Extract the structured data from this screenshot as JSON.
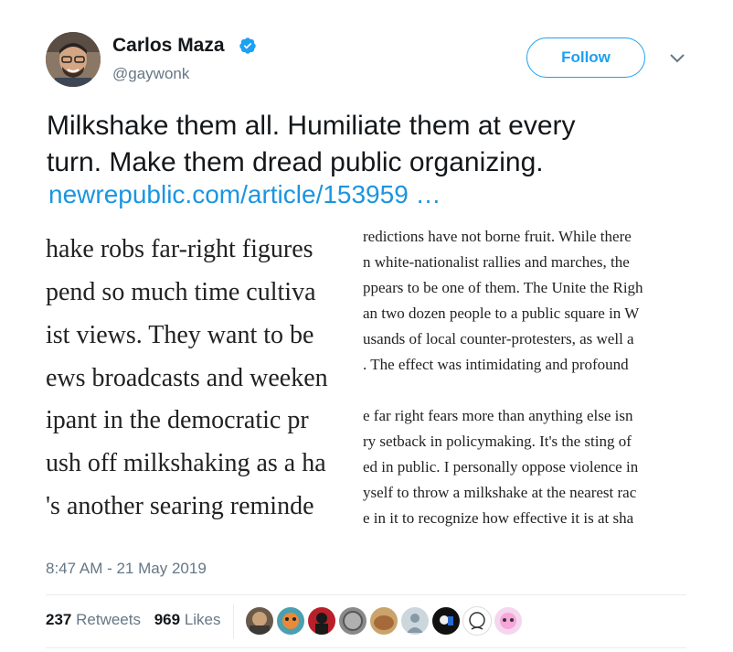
{
  "author": {
    "name": "Carlos Maza",
    "handle": "@gaywonk",
    "verified": true
  },
  "follow_label": "Follow",
  "tweet": {
    "text_line1": "Milkshake them all. Humiliate them at every",
    "text_line2": "turn. Make them dread public organizing.",
    "link": "newrepublic.com/article/153959 …"
  },
  "media": {
    "left_lines": [
      "hake robs far-right figures",
      "pend so much time cultiva",
      "ist views. They want to be",
      "ews broadcasts and weeken",
      "ipant in the democratic pr",
      "ush off milkshaking as a ha",
      "'s another searing reminde"
    ],
    "right_lines": [
      "redictions have not borne fruit. While there",
      "n white-nationalist rallies and marches, the",
      "ppears to be one of them. The Unite the Righ",
      "an two dozen people to a public square in W",
      "usands of local counter-protesters, as well a",
      ". The effect was intimidating and profound",
      "e far right fears more than anything else isn",
      "ry setback in policymaking. It's the sting of",
      "ed in public. I personally oppose violence in",
      "yself to throw a milkshake at the nearest rac",
      "e in it to recognize how effective it is at sha"
    ]
  },
  "timestamp": "8:47 AM - 21 May 2019",
  "stats": {
    "retweets_count": "237",
    "retweets_label": "Retweets",
    "likes_count": "969",
    "likes_label": "Likes"
  },
  "colors": {
    "accent": "#1da1f2",
    "link": "#1b95e0",
    "muted": "#657786"
  }
}
